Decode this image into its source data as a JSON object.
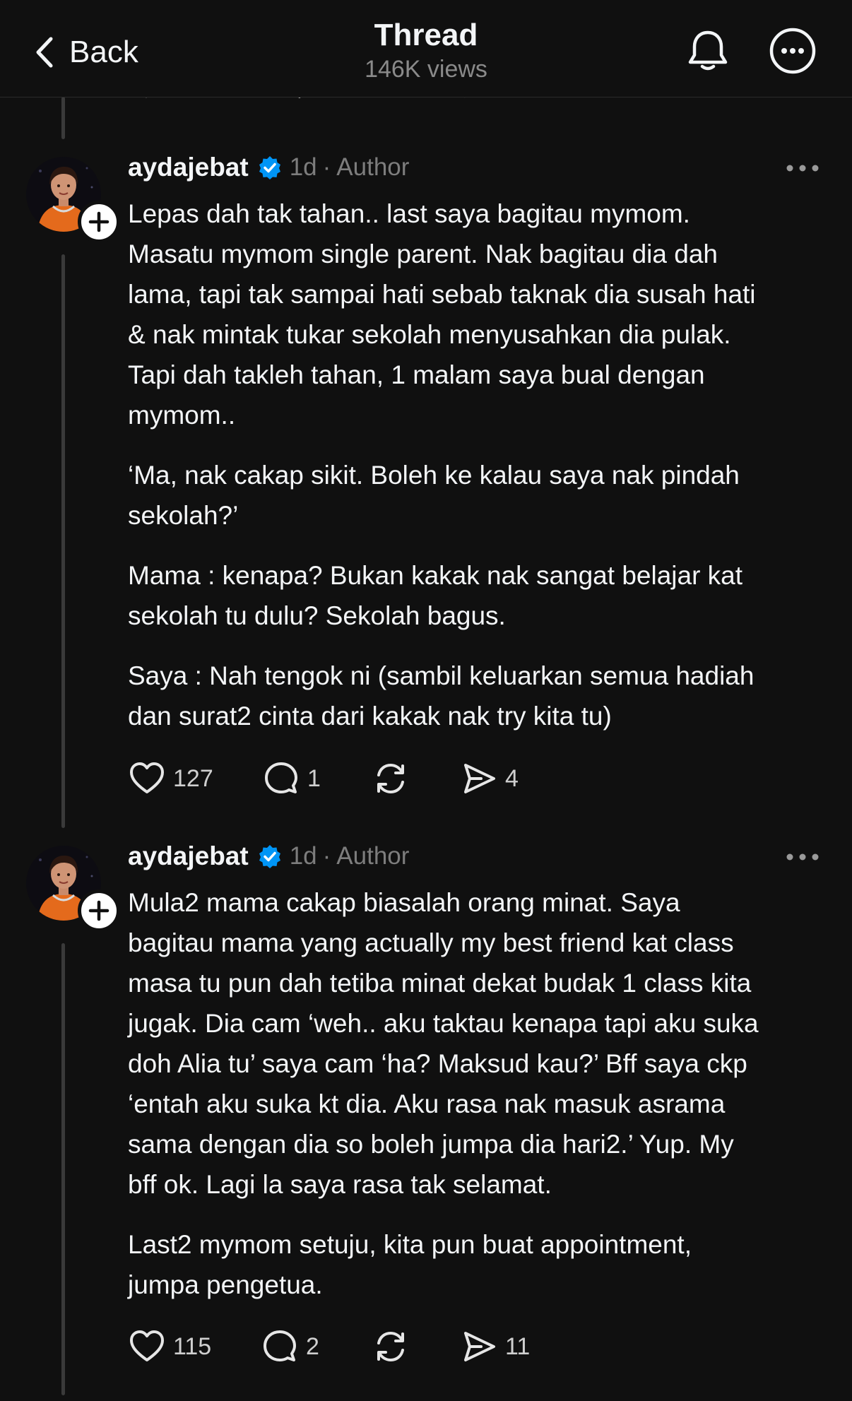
{
  "header": {
    "back_label": "Back",
    "title": "Thread",
    "views": "146K views"
  },
  "posts": [
    {
      "username": "aydajebat",
      "time": "1d",
      "separator": "·",
      "role": "Author",
      "paragraphs": [
        "Lepas dah tak tahan.. last saya bagitau mymom.\nMasatu mymom single parent. Nak bagitau dia dah\nlama, tapi tak sampai hati sebab taknak dia susah hati\n& nak mintak tukar sekolah menyusahkan dia pulak.\nTapi dah takleh tahan, 1 malam saya bual dengan\nmymom..",
        "‘Ma, nak cakap sikit. Boleh ke kalau saya nak pindah\nsekolah?’",
        "Mama : kenapa? Bukan kakak nak sangat belajar kat\nsekolah tu dulu? Sekolah bagus.",
        "Saya : Nah tengok ni (sambil keluarkan semua hadiah\ndan surat2 cinta dari kakak nak try kita tu)"
      ],
      "likes": "127",
      "replies": "1",
      "shares": "4"
    },
    {
      "username": "aydajebat",
      "time": "1d",
      "separator": "·",
      "role": "Author",
      "paragraphs": [
        "Mula2 mama cakap biasalah orang minat. Saya\nbagitau mama yang actually my best friend kat class\nmasa tu pun dah tetiba minat dekat budak 1 class kita\njugak. Dia cam ‘weh.. aku taktau kenapa tapi aku suka\ndoh Alia tu’ saya cam ‘ha? Maksud kau?’ Bff saya ckp\n‘entah aku suka kt dia. Aku rasa nak masuk asrama\nsama dengan dia so boleh jumpa dia hari2.’ Yup. My\nbff ok. Lagi la saya rasa tak selamat.",
        "Last2 mymom setuju, kita pun buat appointment,\njumpa pengetua."
      ],
      "likes": "115",
      "replies": "2",
      "shares": "11"
    }
  ],
  "icons": {
    "back": "chevron-left-icon",
    "notifications": "bell-icon",
    "more": "more-circle-icon",
    "verified": "verified-badge-icon",
    "like": "heart-icon",
    "reply": "comment-icon",
    "repost": "repost-icon",
    "share": "send-icon"
  },
  "colors": {
    "background": "#101010",
    "text": "#f3f5f7",
    "muted": "#7d7d7d",
    "verified": "#0095f6",
    "thread_line": "#3a3a3a"
  }
}
